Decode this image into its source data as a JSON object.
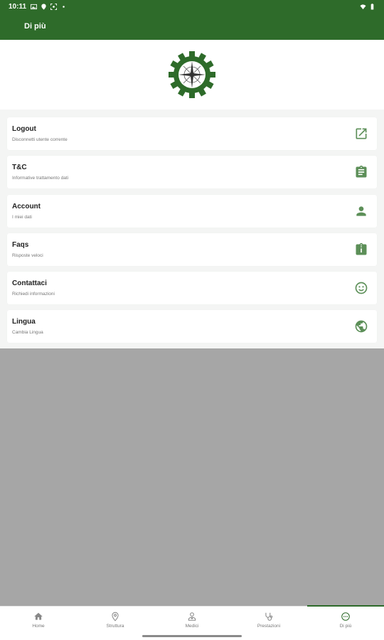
{
  "status_bar": {
    "time": "10:11"
  },
  "app_bar": {
    "title": "Di più"
  },
  "menu": [
    {
      "title": "Logout",
      "subtitle": "Disconnetti utente corrente",
      "icon": "external-link-icon"
    },
    {
      "title": "T&C",
      "subtitle": "Informative trattamento dati",
      "icon": "clipboard-icon"
    },
    {
      "title": "Account",
      "subtitle": "I miei dati",
      "icon": "person-icon"
    },
    {
      "title": "Faqs",
      "subtitle": "Risposte veloci",
      "icon": "clipboard-info-icon"
    },
    {
      "title": "Contattaci",
      "subtitle": "Richiedi informazioni",
      "icon": "smiley-icon"
    },
    {
      "title": "Lingua",
      "subtitle": "Cambia Lingua",
      "icon": "globe-icon"
    }
  ],
  "bottom_nav": [
    {
      "label": "Home",
      "icon": "home-icon"
    },
    {
      "label": "Struttura",
      "icon": "location-pin-icon"
    },
    {
      "label": "Medici",
      "icon": "doctor-icon"
    },
    {
      "label": "Prestazioni",
      "icon": "stethoscope-icon"
    },
    {
      "label": "Di più",
      "icon": "more-icon",
      "active": true
    }
  ],
  "colors": {
    "primary": "#2e6b2a",
    "icon": "#5c8f58",
    "background": "#f4f5f4",
    "overlay": "#a6a6a6"
  }
}
